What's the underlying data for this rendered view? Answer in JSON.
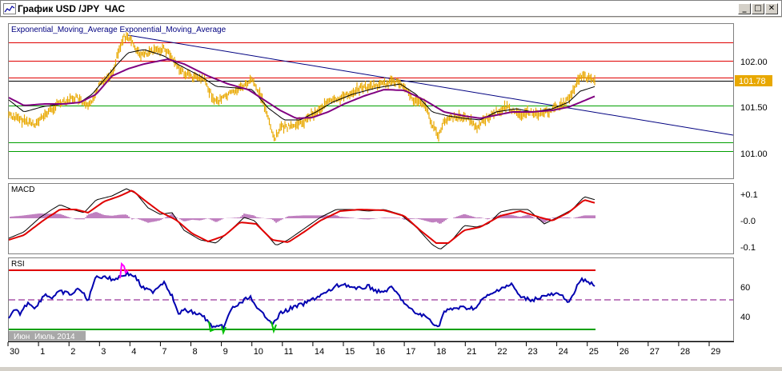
{
  "window": {
    "title": "График USD /JPY  ЧАС",
    "minimize_glyph": "_",
    "maximize_glyph": "□",
    "close_glyph": "✕"
  },
  "main_panel": {
    "indicator_label": "Exponential_Moving_Average Exponential_Moving_Average",
    "price_labels": [
      "102.00",
      "101.50",
      "101.00"
    ],
    "current_price": "101.78",
    "colors": {
      "price": "#e8a800",
      "ema_fast": "#000000",
      "ema_slow": "#800080",
      "trendline": "#000080",
      "resistance": "#e00000",
      "support": "#00a000"
    }
  },
  "macd_panel": {
    "label": "MACD",
    "labels": [
      "+0.1",
      "-0.0",
      "-0.1"
    ],
    "colors": {
      "macd": "#000000",
      "signal": "#e00000",
      "histogram": "#800080"
    }
  },
  "rsi_panel": {
    "label": "RSI",
    "labels": [
      "60",
      "40"
    ],
    "colors": {
      "rsi": "#0000b0",
      "upper": "#e00000",
      "lower": "#00a000",
      "mid": "#800080"
    }
  },
  "x_axis": {
    "ticks": [
      "30",
      "1",
      "2",
      "3",
      "4",
      "7",
      "8",
      "9",
      "10",
      "11",
      "14",
      "15",
      "16",
      "17",
      "18",
      "21",
      "22",
      "23",
      "24",
      "25",
      "26",
      "27",
      "28",
      "29"
    ],
    "month_labels": [
      "Июн",
      "Июль 2014"
    ]
  }
}
